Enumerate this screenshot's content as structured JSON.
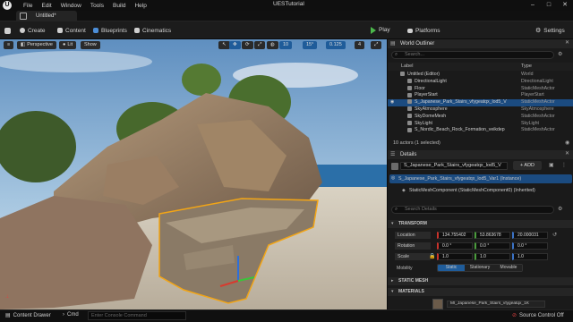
{
  "app": {
    "title": "UESTutorial",
    "menu": [
      "File",
      "Edit",
      "Window",
      "Tools",
      "Build",
      "Help"
    ],
    "tab": "Untitled*"
  },
  "toolbar": {
    "save_icon": "save-icon",
    "create_label": "Create",
    "content_label": "Content",
    "blueprints_label": "Blueprints",
    "cinematics_label": "Cinematics",
    "play_label": "Play",
    "platforms_label": "Platforms",
    "settings_label": "Settings"
  },
  "viewport": {
    "perspective_label": "Perspective",
    "lit_label": "Lit",
    "show_label": "Show",
    "grid_snap": "10",
    "rotation_snap": "15°",
    "scale_snap": "0.125",
    "camera_speed": "4"
  },
  "outliner": {
    "title": "World Outliner",
    "search_placeholder": "Search...",
    "col_label": "Label",
    "col_type": "Type",
    "rows": [
      {
        "label": "Untitled (Editor)",
        "type": "World",
        "indent": 0
      },
      {
        "label": "DirectionalLight",
        "type": "DirectionalLight",
        "indent": 1
      },
      {
        "label": "Floor",
        "type": "StaticMeshActor",
        "indent": 1
      },
      {
        "label": "PlayerStart",
        "type": "PlayerStart",
        "indent": 1
      },
      {
        "label": "S_Japanese_Park_Stairs_vfygeatqx_lod5_V",
        "type": "StaticMeshActor",
        "indent": 1,
        "selected": true
      },
      {
        "label": "SkyAtmosphere",
        "type": "SkyAtmosphere",
        "indent": 1
      },
      {
        "label": "SkyDomeMesh",
        "type": "StaticMeshActor",
        "indent": 1
      },
      {
        "label": "SkyLight",
        "type": "SkyLight",
        "indent": 1
      },
      {
        "label": "S_Nordic_Beach_Rock_Formation_veikdep",
        "type": "StaticMeshActor",
        "indent": 1
      }
    ],
    "footer": "10 actors (1 selected)"
  },
  "details": {
    "title": "Details",
    "actor_name": "S_Japanese_Park_Stairs_vfygeatqx_lod5_V",
    "add_label": "+ ADD",
    "instance_label": "S_Japanese_Park_Stairs_vfygeatqx_lod5_Var1 (Instance)",
    "component_label": "StaticMeshComponent (StaticMeshComponent0) (Inherited)",
    "search_placeholder": "Search Details",
    "transform_header": "TRANSFORM",
    "location_label": "Location",
    "rotation_label": "Rotation",
    "scale_label": "Scale",
    "mobility_label": "Mobility",
    "location": [
      "134.755402",
      "53.863678",
      "20.000031"
    ],
    "rotation": [
      "0.0 °",
      "0.0 °",
      "0.0 °"
    ],
    "scale": [
      "1.0",
      "1.0",
      "1.0"
    ],
    "mobility_options": [
      "Static",
      "Stationary",
      "Movable"
    ],
    "static_mesh_header": "STATIC MESH",
    "materials_header": "MATERIALS",
    "material_value": "MI_Japanese_Park_Stairs_vfygeatqx_1K"
  },
  "status": {
    "content_drawer": "Content Drawer",
    "cmd": "Cmd",
    "console_placeholder": "Enter Console Command",
    "source_control": "Source Control Off"
  },
  "colors": {
    "accent": "#1f5c9a",
    "play_green": "#4bb84b",
    "selection_outline": "#f2a516"
  }
}
